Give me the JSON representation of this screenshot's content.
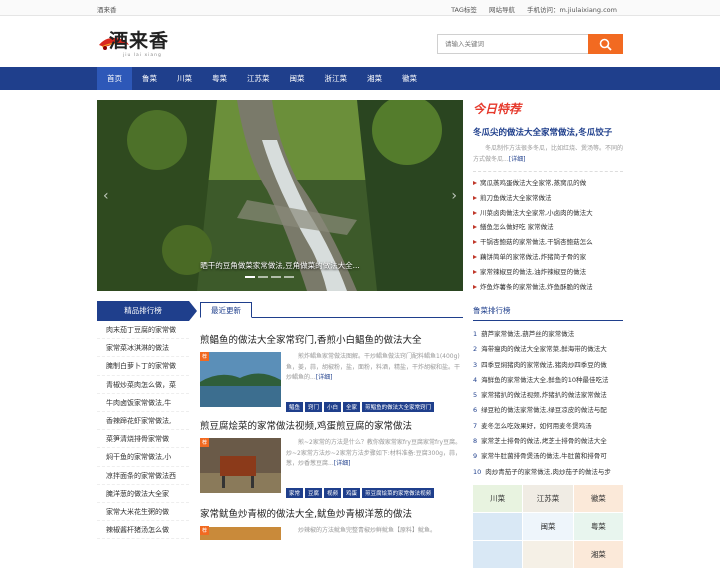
{
  "topbar": {
    "site_name": "酒来香",
    "links": [
      "TAG标签",
      "网站导航",
      "手机访问：m.jiulaixiang.com"
    ]
  },
  "logo": {
    "brand": "酒来香",
    "subtitle": "jiu lai xiang"
  },
  "search": {
    "placeholder": "请输入关键词"
  },
  "nav": [
    "首页",
    "鲁菜",
    "川菜",
    "粤菜",
    "江苏菜",
    "闽菜",
    "浙江菜",
    "湘菜",
    "徽菜"
  ],
  "slider": {
    "caption": "晒干的豆角做菜家常做法,豆角做菜的做法大全..."
  },
  "rank": {
    "title": "精品排行榜",
    "items": [
      "肉末茄丁豆腐的家常做",
      "家常菜冰淇淋的做法",
      "腌制白萝卜丁的家常做",
      "青椒炒菜肉怎么做，菜",
      "牛肉卤饭家常做法,牛",
      "香辣蹄花虾家常做法,",
      "菜笋清烧排骨家常做",
      "焖干鱼的家常做法,小",
      "凉拌面条的家常做法西",
      "腌洋葱的做法大全家",
      "家常大米花生粥的做",
      "辣椒酱杆猪汤怎么做"
    ]
  },
  "latest": {
    "tab": "最近更新",
    "articles": [
      {
        "title": "煎鲳鱼的做法大全家常窍门,香煎小白鲳鱼的做法大全",
        "badge": "荐",
        "desc": "煎炸鲳鱼家常做法图解。干炒鲳鱼做法窍门配料鲳鱼1(400g)鱼，姜，蒜，胡椒粉，盐，面粉，料酒，精盐，干炸胡椒和盐。干炒鲳鱼的...",
        "more": "[详细]",
        "tags": [
          "鲳鱼",
          "窍门",
          "小白",
          "全家",
          "煎鲳鱼的做法大全家常窍门"
        ]
      },
      {
        "title": "煎豆腐烩菜的家常做法视频,鸡蛋煎豆腐的家常做法",
        "badge": "荐",
        "desc": "煎~2家常的方法是什么？教你做家常家fry豆腐家常fry豆腐。炒~2家常方法炒~2家常方法步骤如下:材料准备:豆腐300g，蒜，葱，炒香葱豆腐...",
        "more": "[详细]",
        "tags": [
          "家常",
          "豆腐",
          "视频",
          "鸡蛋",
          "煎豆腐烩菜的家常做法视频"
        ]
      },
      {
        "title": "家常鱿鱼炒青椒的做法大全,鱿鱼炒青椒洋葱的做法",
        "badge": "荐",
        "desc": "炒辣椒的方法鱿鱼完整青椒炒鲜鱿鱼【原料】鱿鱼。",
        "more": "",
        "tags": []
      }
    ]
  },
  "today": {
    "logo": "今日特荐",
    "feature_title": "冬瓜尖的做法大全家常做法,冬瓜饺子",
    "feature_desc": "冬瓜制作方法很多冬瓜，比如红烧、煲汤等。不同的方式做冬瓜...",
    "more": "[详细]",
    "items": [
      "窝瓜蒸鸡蛋做法大全家常,蒸窝瓜的做",
      "煎刀鱼做法大全家常做法",
      "川菜卤肉做法大全家常,小卤肉的做法大",
      "鳝鱼怎么做好吃 家常做法",
      "干锅杏鲍菇的家常做法,干锅杏鲍菇怎么",
      "藕饼简单的家常做法,炸猪简子骨的家",
      "家常辣椒豆的做法,油炸辣椒豆的做法",
      "炸鱼炸薯条的家常做法,炸鱼酥脆的做法"
    ]
  },
  "lurank": {
    "title": "鲁菜排行榜",
    "items": [
      "葫芦家常做法,葫芦丝的家常做法",
      "海带瘦肉的做法大全家常菜,鲜海带的做法大",
      "四季豆焖猪肉的家常做法,猪肉炒四季豆的做",
      "海鲜鱼的家常做法大全,鲜鱼的10种最佳吃法",
      "家常猪扒的做法视频,炸猪扒的做法家常做法",
      "绿豆粒的做法家常做法,绿豆凉皮的做法与配",
      "麦冬怎么吃效果好，如何用麦冬煲鸡汤",
      "家常芝士排骨的做法,烤芝士排骨的做法大全",
      "家常牛肚菌排骨煲汤的做法,牛肚菌和排骨可",
      "肉炒青茄子的家常做法,肉炒茄子的做法与步"
    ]
  },
  "grid": [
    "川菜",
    "江苏菜",
    "徽菜",
    "",
    "闽菜",
    "粤菜",
    "",
    "",
    "湘菜"
  ],
  "colors": {
    "nav": "#1f3f8c",
    "accent": "#f26a21"
  }
}
